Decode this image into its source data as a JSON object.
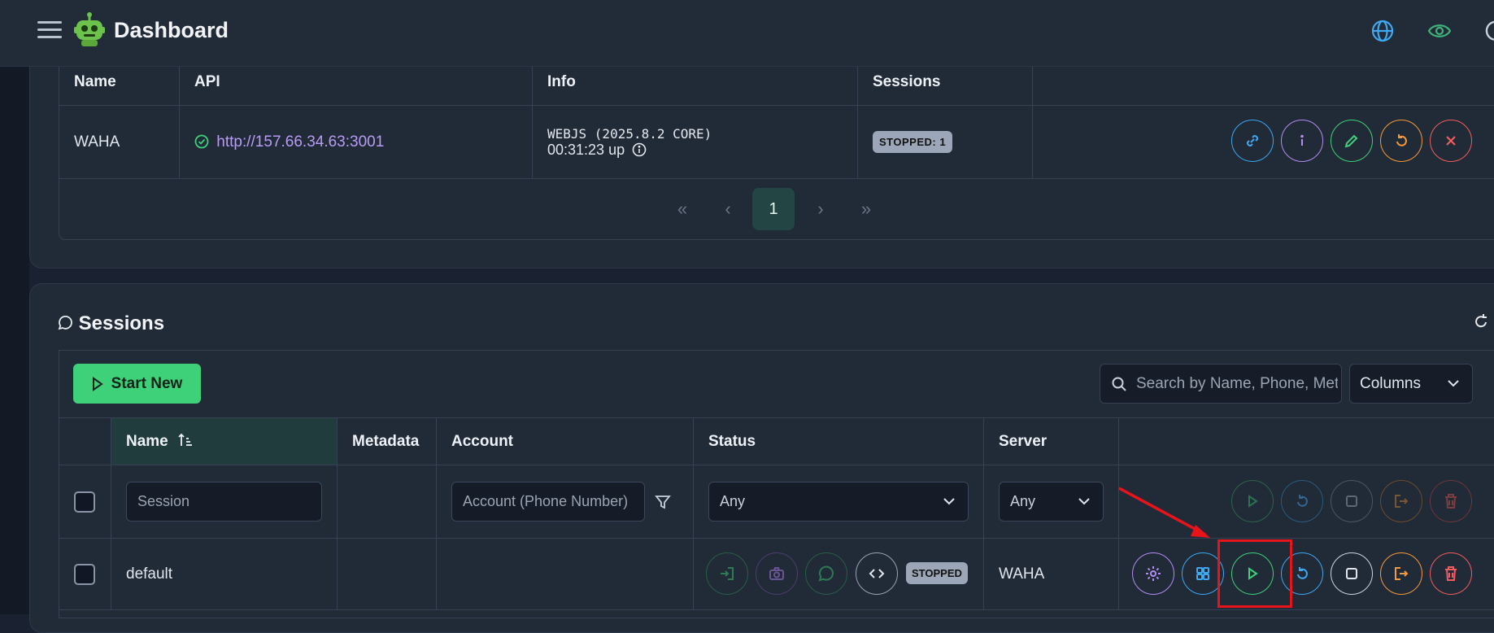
{
  "header": {
    "title": "Dashboard"
  },
  "servers": {
    "columns": [
      "Name",
      "API",
      "Info",
      "Sessions"
    ],
    "row": {
      "name": "WAHA",
      "api": "http://157.66.34.63:3001",
      "engine": "WEBJS (2025.8.2 CORE)",
      "uptime": "00:31:23 up",
      "sessions_badge": "STOPPED: 1"
    },
    "pagination": {
      "first": "«",
      "prev": "‹",
      "page": "1",
      "next": "›",
      "last": "»"
    }
  },
  "sessions": {
    "title": "Sessions",
    "start_new": "Start New",
    "search_placeholder": "Search by Name, Phone, Metadata",
    "columns_label": "Columns",
    "columns": {
      "name": "Name",
      "metadata": "Metadata",
      "account": "Account",
      "status": "Status",
      "server": "Server"
    },
    "filters": {
      "session_placeholder": "Session",
      "account_placeholder": "Account (Phone Number)",
      "status_value": "Any",
      "server_value": "Any"
    },
    "row": {
      "name": "default",
      "status_badge": "STOPPED",
      "server": "WAHA"
    }
  },
  "colors": {
    "green": "#3fd07a",
    "blue": "#3ea8f0",
    "purple": "#b48cf2",
    "orange": "#f59a3a",
    "red": "#f25c5c",
    "highlight": "#e8141a"
  }
}
